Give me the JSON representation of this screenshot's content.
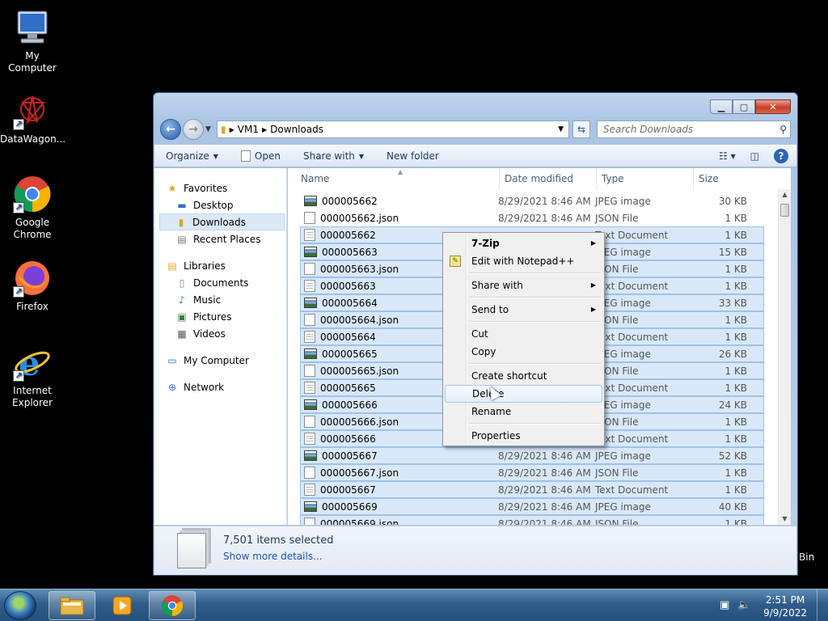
{
  "desktop": {
    "icons": [
      {
        "label": "My Computer",
        "icon": "computer-icon"
      },
      {
        "label": "DataWagon...",
        "icon": "datawagon-icon"
      },
      {
        "label": "Google Chrome",
        "icon": "chrome-icon"
      },
      {
        "label": "Firefox",
        "icon": "firefox-icon"
      },
      {
        "label": "Internet Explorer",
        "icon": "ie-icon"
      }
    ],
    "bin_label": "Bin"
  },
  "window": {
    "address": {
      "segments": [
        "VM1",
        "Downloads"
      ]
    },
    "search_placeholder": "Search Downloads",
    "toolbar": {
      "organize": "Organize",
      "open": "Open",
      "share_with": "Share with",
      "new_folder": "New folder"
    },
    "nav": {
      "favorites": "Favorites",
      "desktop": "Desktop",
      "downloads": "Downloads",
      "recent_places": "Recent Places",
      "libraries": "Libraries",
      "documents": "Documents",
      "music": "Music",
      "pictures": "Pictures",
      "videos": "Videos",
      "my_computer": "My Computer",
      "network": "Network"
    },
    "columns": {
      "name": "Name",
      "date": "Date modified",
      "type": "Type",
      "size": "Size"
    },
    "files": [
      {
        "name": "000005662",
        "date": "8/29/2021 8:46 AM",
        "type": "JPEG image",
        "size": "30 KB",
        "icon": "jpg",
        "selected": false
      },
      {
        "name": "000005662.json",
        "date": "8/29/2021 8:46 AM",
        "type": "JSON File",
        "size": "1 KB",
        "icon": "file",
        "selected": false
      },
      {
        "name": "000005662",
        "date": "",
        "type": "Text Document",
        "size": "1 KB",
        "icon": "txt",
        "selected": true
      },
      {
        "name": "000005663",
        "date": "",
        "type": "JPEG image",
        "size": "15 KB",
        "icon": "jpg",
        "selected": true
      },
      {
        "name": "000005663.json",
        "date": "",
        "type": "JSON File",
        "size": "1 KB",
        "icon": "file",
        "selected": true
      },
      {
        "name": "000005663",
        "date": "",
        "type": "Text Document",
        "size": "1 KB",
        "icon": "txt",
        "selected": true
      },
      {
        "name": "000005664",
        "date": "",
        "type": "JPEG image",
        "size": "33 KB",
        "icon": "jpg",
        "selected": true
      },
      {
        "name": "000005664.json",
        "date": "",
        "type": "JSON File",
        "size": "1 KB",
        "icon": "file",
        "selected": true
      },
      {
        "name": "000005664",
        "date": "",
        "type": "Text Document",
        "size": "1 KB",
        "icon": "txt",
        "selected": true
      },
      {
        "name": "000005665",
        "date": "",
        "type": "JPEG image",
        "size": "26 KB",
        "icon": "jpg",
        "selected": true
      },
      {
        "name": "000005665.json",
        "date": "",
        "type": "JSON File",
        "size": "1 KB",
        "icon": "file",
        "selected": true
      },
      {
        "name": "000005665",
        "date": "",
        "type": "Text Document",
        "size": "1 KB",
        "icon": "txt",
        "selected": true
      },
      {
        "name": "000005666",
        "date": "",
        "type": "JPEG image",
        "size": "24 KB",
        "icon": "jpg",
        "selected": true
      },
      {
        "name": "000005666.json",
        "date": "",
        "type": "JSON File",
        "size": "1 KB",
        "icon": "file",
        "selected": true
      },
      {
        "name": "000005666",
        "date": "",
        "type": "Text Document",
        "size": "1 KB",
        "icon": "txt",
        "selected": true
      },
      {
        "name": "000005667",
        "date": "8/29/2021 8:46 AM",
        "type": "JPEG image",
        "size": "52 KB",
        "icon": "jpg",
        "selected": true
      },
      {
        "name": "000005667.json",
        "date": "8/29/2021 8:46 AM",
        "type": "JSON File",
        "size": "1 KB",
        "icon": "file",
        "selected": true
      },
      {
        "name": "000005667",
        "date": "8/29/2021 8:46 AM",
        "type": "Text Document",
        "size": "1 KB",
        "icon": "txt",
        "selected": true
      },
      {
        "name": "000005669",
        "date": "8/29/2021 8:46 AM",
        "type": "JPEG image",
        "size": "40 KB",
        "icon": "jpg",
        "selected": true
      },
      {
        "name": "000005669.json",
        "date": "8/29/2021 8:46 AM",
        "type": "JSON File",
        "size": "1 KB",
        "icon": "file",
        "selected": true
      }
    ],
    "details": {
      "count": "7,501 items selected",
      "more": "Show more details..."
    }
  },
  "context_menu": {
    "items": [
      {
        "label": "7-Zip",
        "bold": true,
        "submenu": true
      },
      {
        "label": "Edit with Notepad++",
        "icon": "notepadpp-icon"
      },
      {
        "sep": true
      },
      {
        "label": "Share with",
        "submenu": true
      },
      {
        "sep": true
      },
      {
        "label": "Send to",
        "submenu": true
      },
      {
        "sep": true
      },
      {
        "label": "Cut"
      },
      {
        "label": "Copy"
      },
      {
        "sep": true
      },
      {
        "label": "Create shortcut"
      },
      {
        "label": "Delete",
        "hover": true
      },
      {
        "label": "Rename"
      },
      {
        "sep": true
      },
      {
        "label": "Properties"
      }
    ]
  },
  "taskbar": {
    "time": "2:51 PM",
    "date": "9/9/2022"
  }
}
